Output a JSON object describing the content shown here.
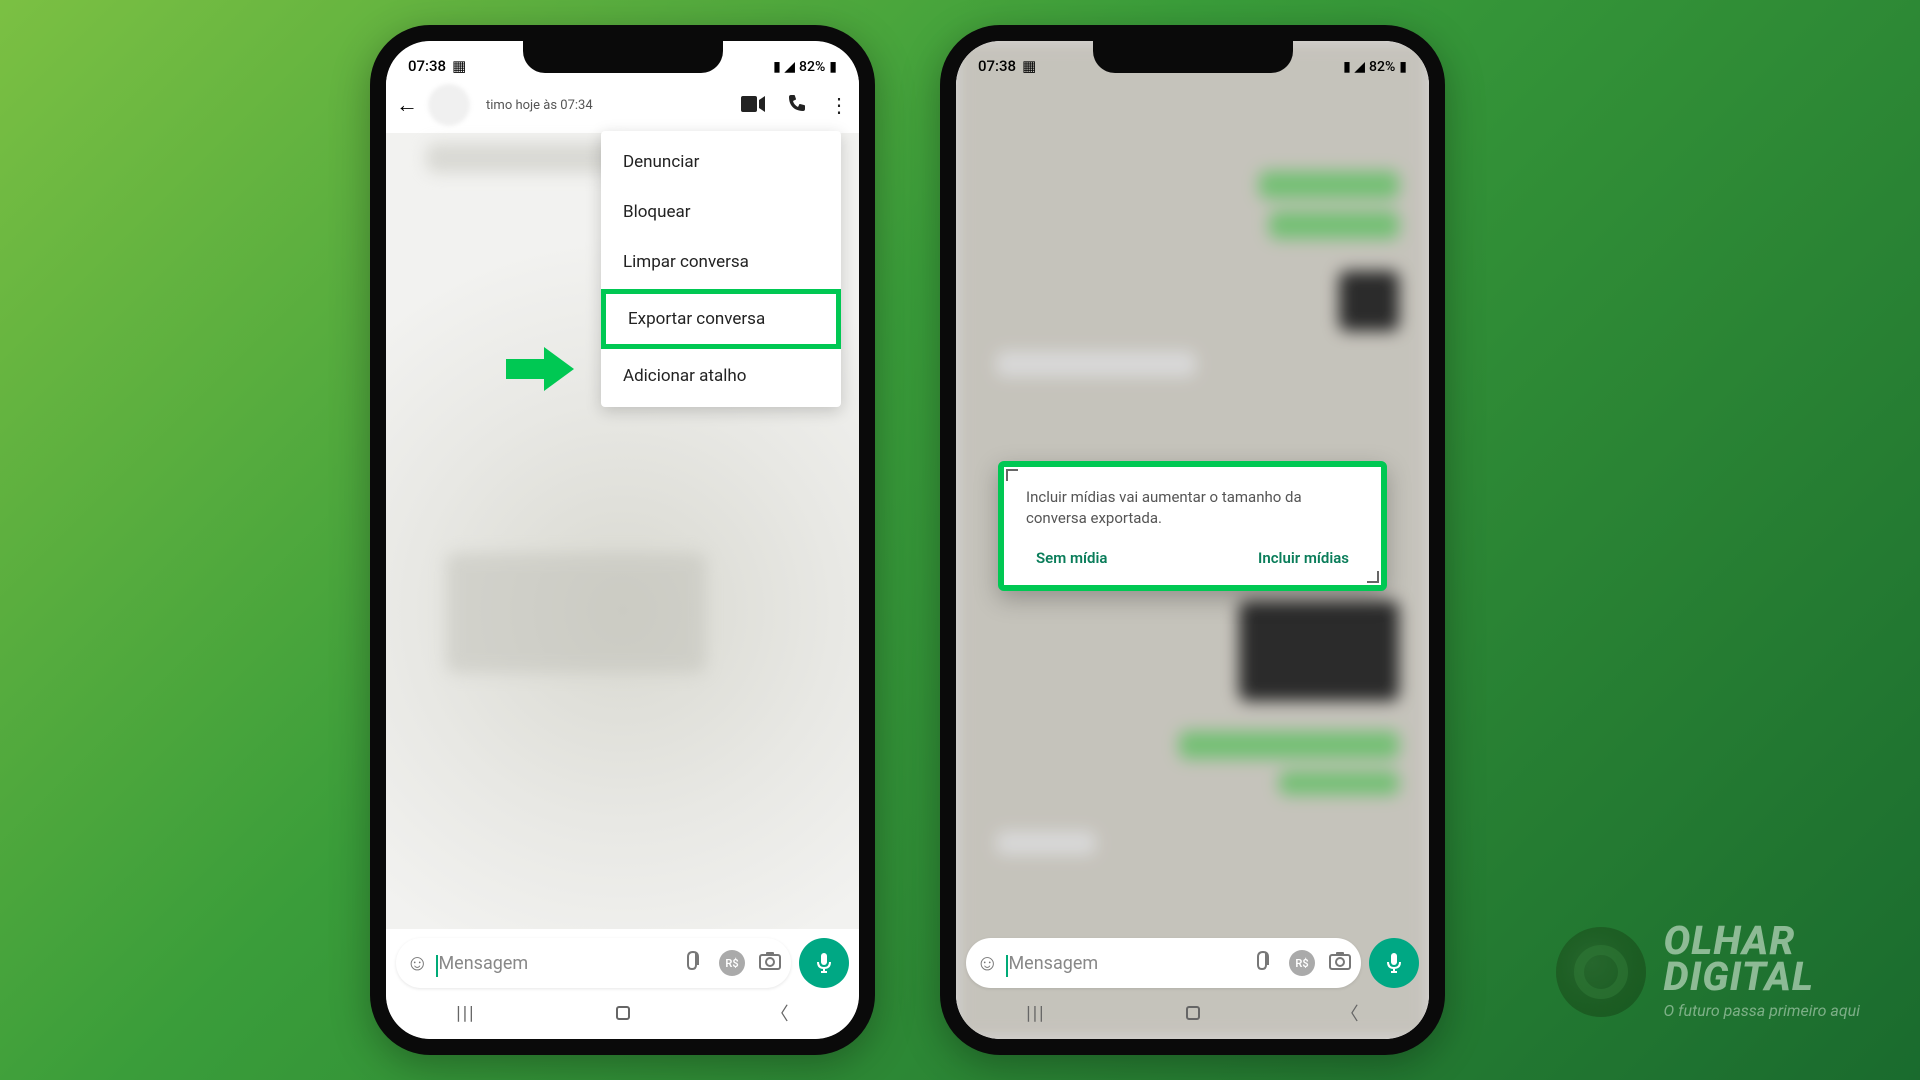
{
  "status": {
    "time": "07:38",
    "battery": "82%"
  },
  "chat": {
    "subtitle": "timo hoje às 07:34",
    "input_placeholder": "Mensagem"
  },
  "menu": {
    "items": [
      "Denunciar",
      "Bloquear",
      "Limpar conversa",
      "Exportar conversa",
      "Adicionar atalho"
    ],
    "highlight_index": 3
  },
  "dialog": {
    "message": "Incluir mídias vai aumentar o tamanho da conversa exportada.",
    "btn_without": "Sem mídia",
    "btn_with": "Incluir mídias"
  },
  "watermark": {
    "title1": "OLHAR",
    "title2": "DIGITAL",
    "tagline": "O futuro passa primeiro aqui"
  }
}
